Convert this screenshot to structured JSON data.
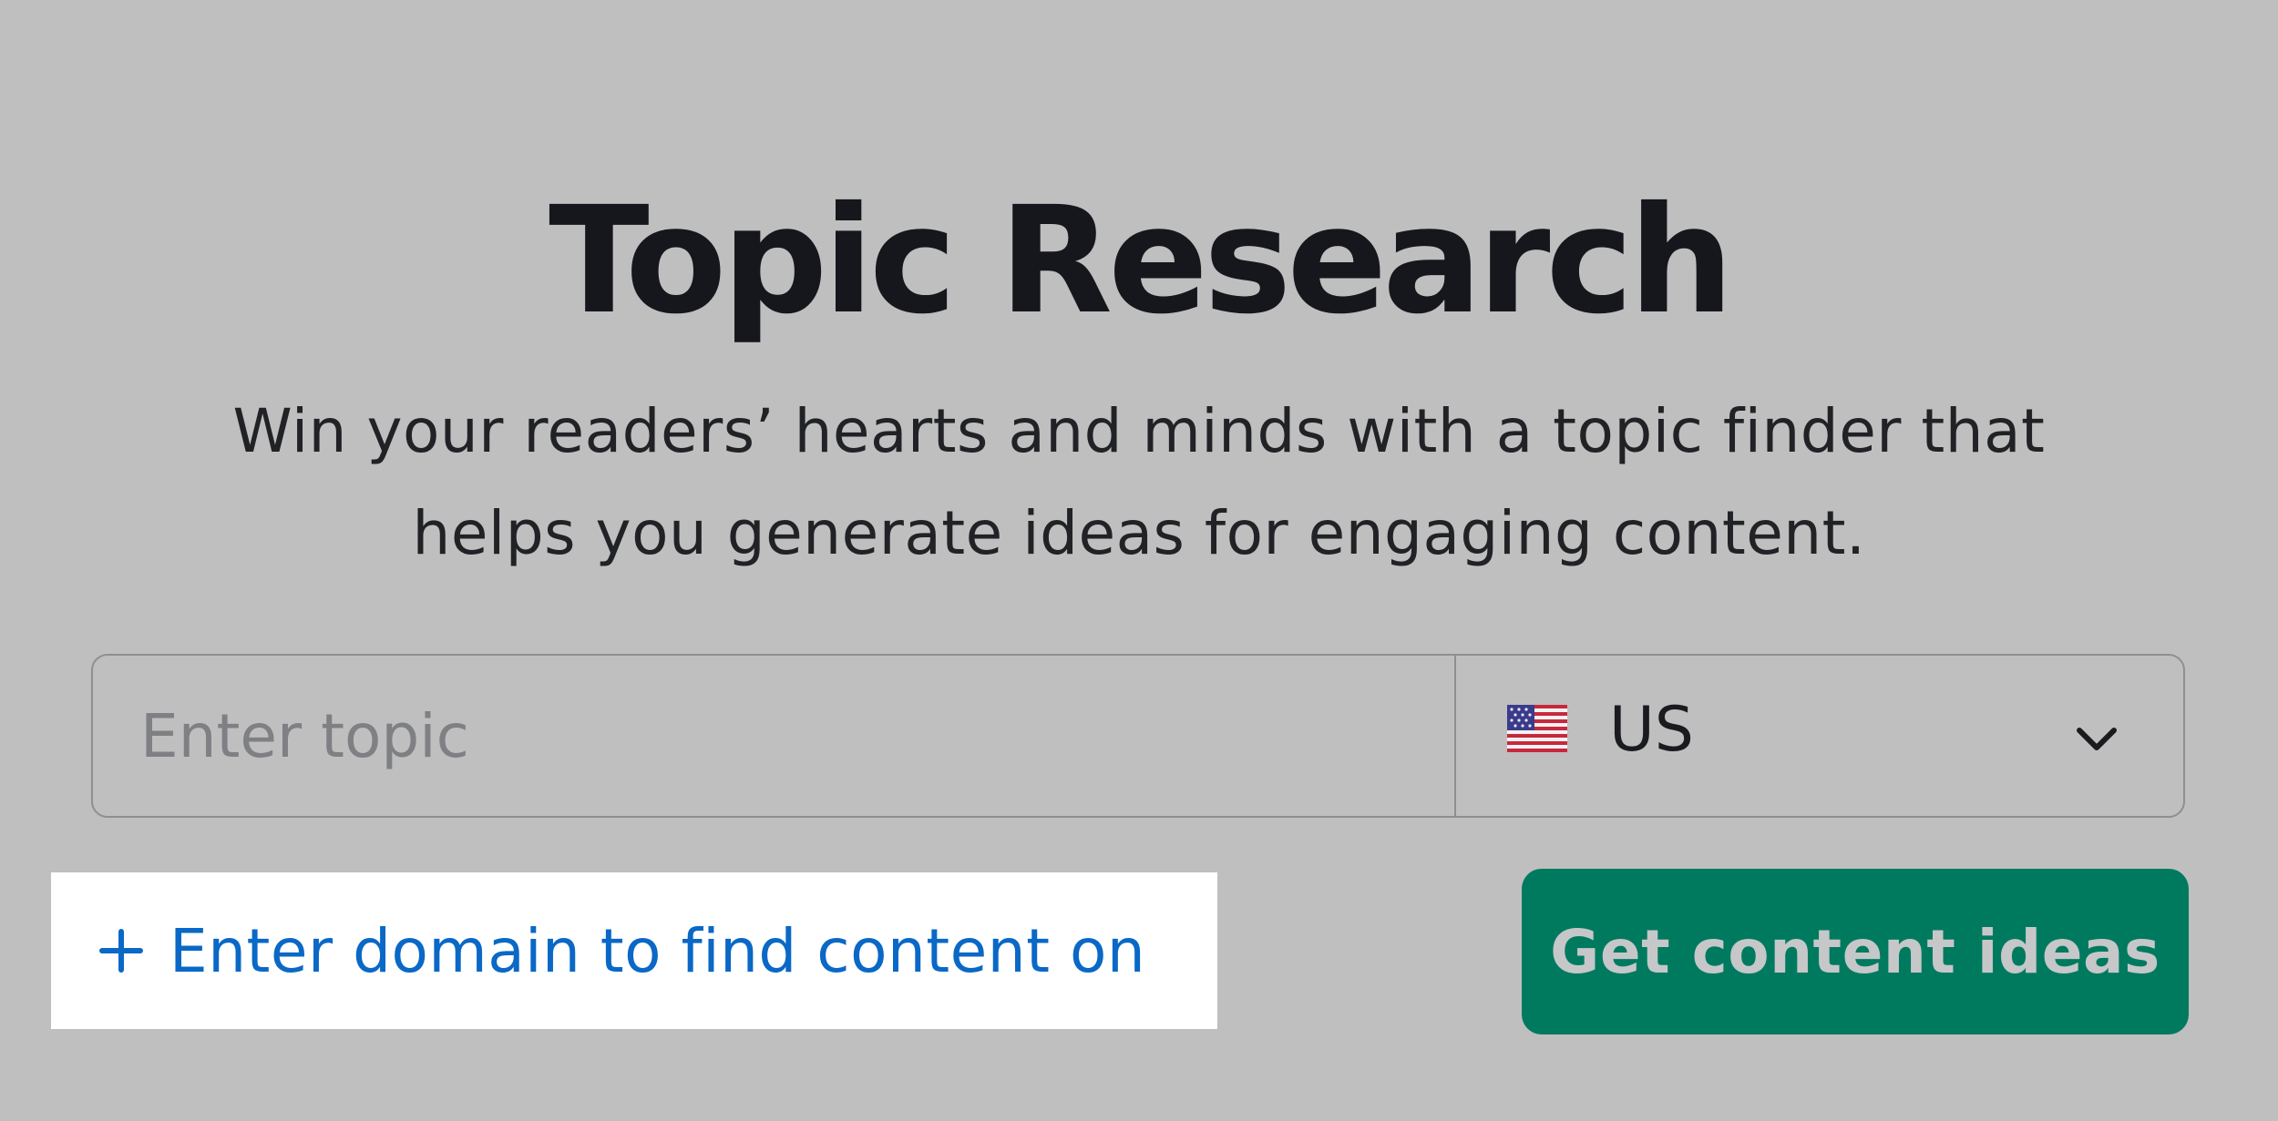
{
  "header": {
    "title": "Topic Research",
    "subtitle": "Win your readers’ hearts and minds with a topic finder that helps you generate ideas for engaging content."
  },
  "search": {
    "topic_placeholder": "Enter topic",
    "topic_value": "",
    "country_flag_icon": "us-flag-icon",
    "country_value": "US",
    "dropdown_icon": "chevron-down-icon"
  },
  "actions": {
    "domain_icon": "plus-icon",
    "domain_link_label": "Enter domain to find content on",
    "submit_label": "Get content ideas"
  },
  "colors": {
    "background": "#bfbfbf",
    "link_blue": "#0a68c6",
    "button_green": "#007a5f",
    "title_text": "#16171c"
  }
}
